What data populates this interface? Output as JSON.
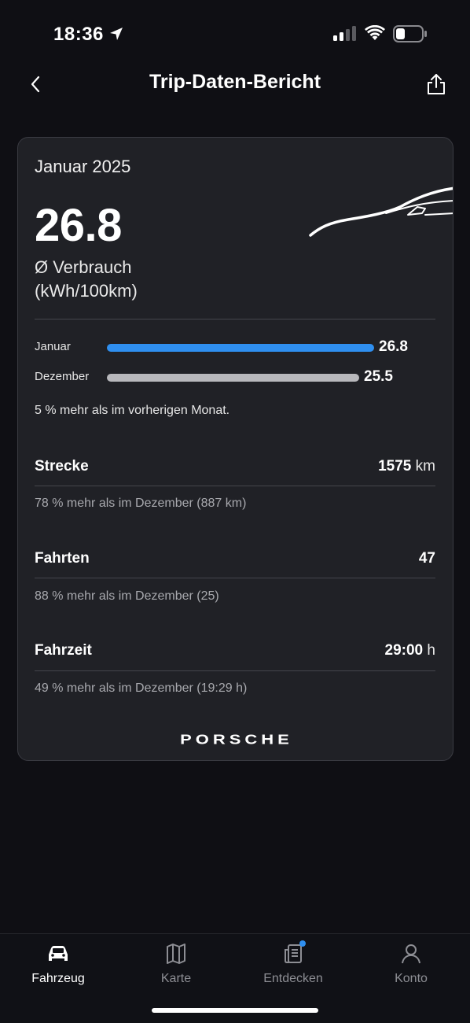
{
  "status_bar": {
    "time": "18:36"
  },
  "header": {
    "title": "Trip-Daten-Bericht"
  },
  "report": {
    "month": "Januar 2025",
    "consumption_value": "26.8",
    "consumption_label_line1": "Ø Verbrauch",
    "consumption_label_line2": "(kWh/100km)",
    "comparison": [
      {
        "label": "Januar",
        "value": "26.8",
        "numeric": 26.8,
        "color": "#2f8ff0"
      },
      {
        "label": "Dezember",
        "value": "25.5",
        "numeric": 25.5,
        "color": "#b8b8bc"
      }
    ],
    "comparison_note": "5 % mehr als im vorherigen Monat.",
    "stats": [
      {
        "label": "Strecke",
        "value": "1575",
        "unit": "km",
        "note": "78 % mehr als im Dezember (887 km)"
      },
      {
        "label": "Fahrten",
        "value": "47",
        "unit": "",
        "note": "88 % mehr als im Dezember (25)"
      },
      {
        "label": "Fahrzeit",
        "value": "29:00",
        "unit": "h",
        "note": "49 % mehr als im Dezember (19:29 h)"
      }
    ],
    "brand": "PORSCHE"
  },
  "tab_bar": {
    "tabs": [
      {
        "label": "Fahrzeug",
        "icon": "car-icon",
        "active": true
      },
      {
        "label": "Karte",
        "icon": "map-icon",
        "active": false
      },
      {
        "label": "Entdecken",
        "icon": "news-icon",
        "active": false,
        "badge": true
      },
      {
        "label": "Konto",
        "icon": "person-icon",
        "active": false
      }
    ]
  },
  "colors": {
    "background": "#0f0f14",
    "card": "#202126",
    "accent_blue": "#2f8ff0",
    "bar_grey": "#b8b8bc"
  }
}
